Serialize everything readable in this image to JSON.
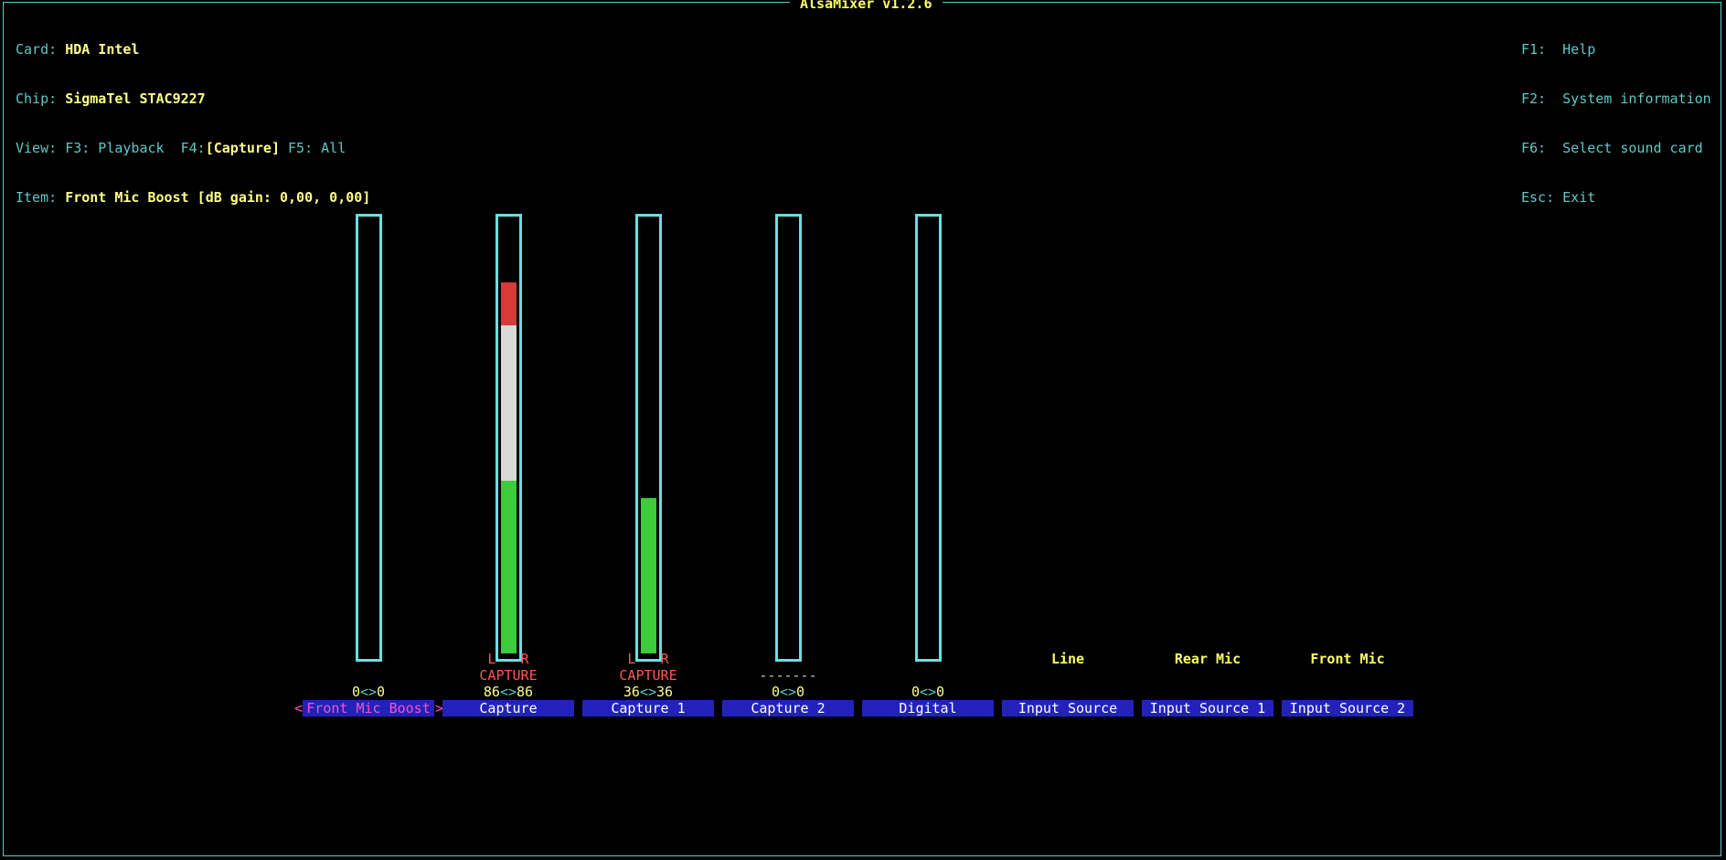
{
  "title": "AlsaMixer v1.2.6",
  "info": {
    "card_label": "Card:",
    "card": "HDA Intel",
    "chip_label": "Chip:",
    "chip": "SigmaTel STAC9227",
    "view_label": "View:",
    "view_f3": "F3: Playback",
    "view_f4": "F4:",
    "view_f4_val": "[Capture]",
    "view_f5": "F5: All",
    "item_label": "Item:",
    "item": "Front Mic Boost [dB gain: 0,00, 0,00]"
  },
  "keys": {
    "f1": "F1:  Help",
    "f2": "F2:  System information",
    "f6": "F6:  Select sound card",
    "esc": "Esc: Exit"
  },
  "channels": [
    {
      "name": "Front Mic Boost",
      "value_l": "0",
      "value_r": "0",
      "mode": "",
      "lr": "",
      "selected": true,
      "level": 0
    },
    {
      "name": "Capture",
      "value_l": "86",
      "value_r": "86",
      "mode": "CAPTURE",
      "lr": "L   R",
      "level": 0.86
    },
    {
      "name": "Capture 1",
      "value_l": "36",
      "value_r": "36",
      "mode": "CAPTURE",
      "lr": "L   R",
      "level": 0.36
    },
    {
      "name": "Capture 2",
      "value_l": "0",
      "value_r": "0",
      "mode": "-------",
      "lr": "",
      "level": 0
    },
    {
      "name": "Digital",
      "value_l": "0",
      "value_r": "0",
      "mode": "",
      "lr": "",
      "level": 0
    },
    {
      "name": "Input Source",
      "source": "Line"
    },
    {
      "name": "Input Source 1",
      "source": "Rear Mic"
    },
    {
      "name": "Input Source 2",
      "source": "Front Mic"
    }
  ],
  "colors": {
    "border": "#5fc8c8",
    "bar_border": "#66e0e0",
    "label_bg": "#2222bb",
    "selected_text": "#ff4fc4",
    "level_green": "#3ccc3c",
    "level_white": "#d8d8d8",
    "level_red": "#d83a3a",
    "capture_text": "#ff5555",
    "value_text": "#ffff88"
  }
}
